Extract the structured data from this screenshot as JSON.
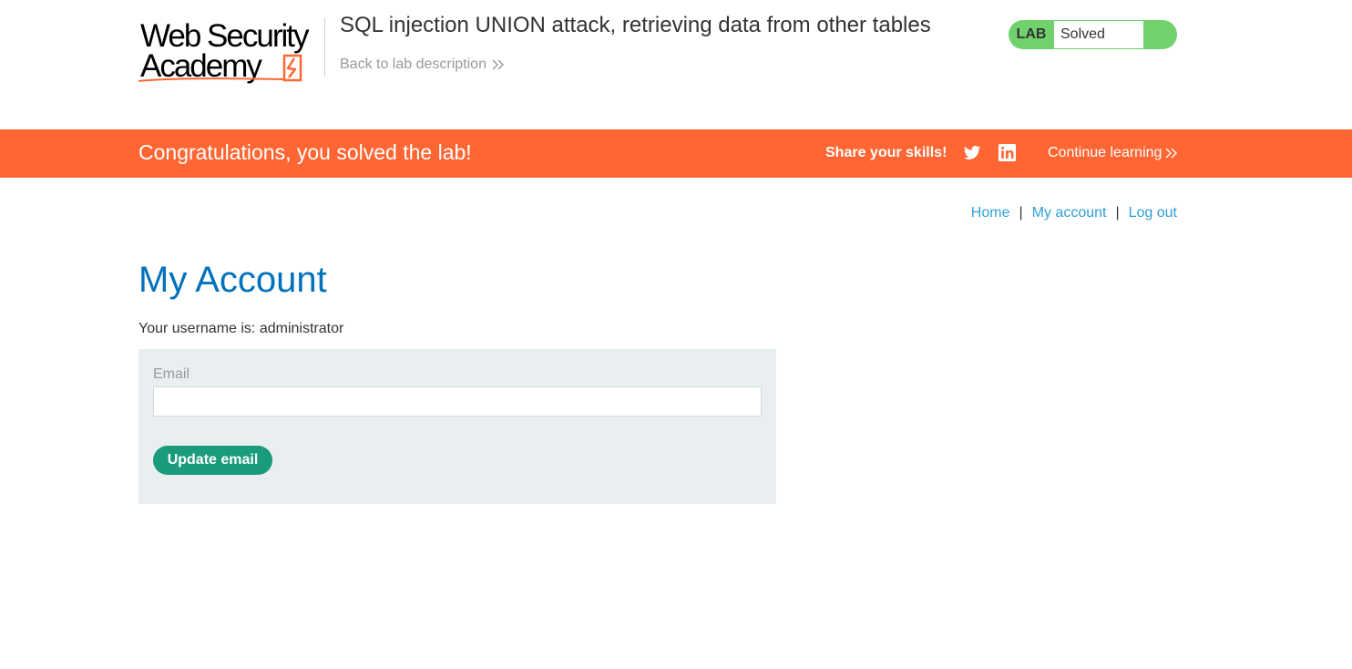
{
  "header": {
    "logo_line1": "Web Security",
    "logo_line2": "Academy",
    "lab_title": "SQL injection UNION attack, retrieving data from other tables",
    "back_link": "Back to lab description",
    "lab_tag": "LAB",
    "lab_status": "Solved"
  },
  "banner": {
    "message": "Congratulations, you solved the lab!",
    "share_label": "Share your skills!",
    "continue_label": "Continue learning",
    "icons": [
      "twitter-icon",
      "linkedin-icon"
    ]
  },
  "nav": {
    "home": "Home",
    "separator": "|",
    "my_account": "My account",
    "log_out": "Log out"
  },
  "main": {
    "title": "My Account",
    "username_line": "Your username is: administrator",
    "email_label": "Email",
    "email_value": "",
    "update_button": "Update email"
  },
  "colors": {
    "brand_orange": "#ff6633",
    "solved_green": "#70d16d",
    "link_blue": "#2f9fd6",
    "title_blue": "#0071bc",
    "button_green": "#1a9b7c",
    "form_bg": "#e9eff1"
  }
}
